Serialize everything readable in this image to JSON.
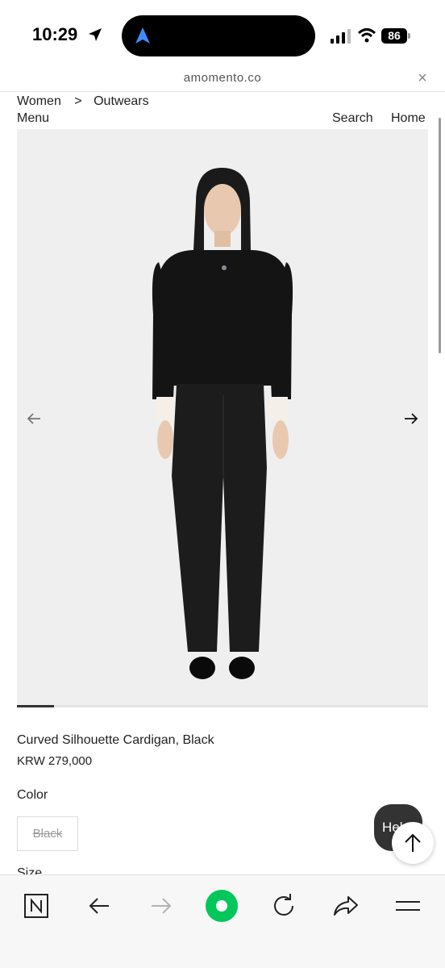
{
  "status_bar": {
    "time": "10:29",
    "battery": "86"
  },
  "browser": {
    "url": "amomento.co",
    "close_symbol": "×"
  },
  "header": {
    "breadcrumb": [
      "Women",
      ">",
      "Outwears"
    ],
    "menu_label": "Menu",
    "search_label": "Search",
    "home_label": "Home"
  },
  "gallery": {
    "current_slide_fraction": 0.09
  },
  "product": {
    "name": "Curved Silhouette Cardigan, Black",
    "price": "KRW 279,000",
    "color_label": "Color",
    "color_options": [
      "Black"
    ],
    "size_label": "Size"
  },
  "floating": {
    "help_label": "Help"
  },
  "toolbar": {
    "items": [
      "naver-home-icon",
      "back-arrow-icon",
      "forward-arrow-icon",
      "green-dot-icon",
      "reload-icon",
      "share-icon",
      "menu-lines-icon"
    ],
    "accent": "#03c75a"
  }
}
